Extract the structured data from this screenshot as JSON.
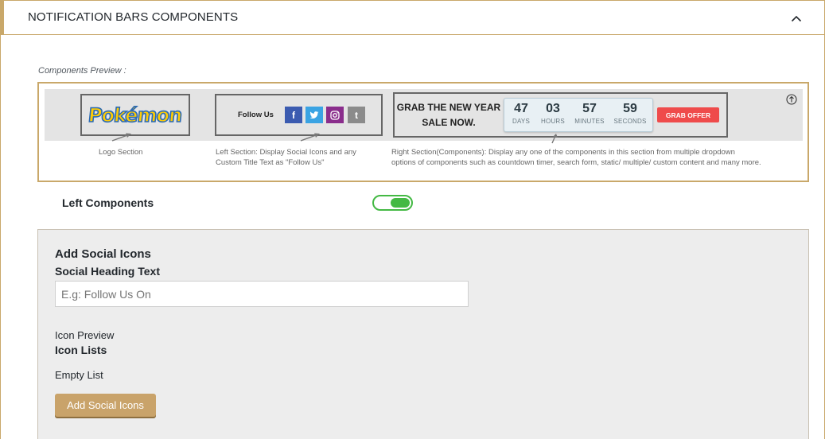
{
  "panel": {
    "title": "NOTIFICATION BARS COMPONENTS"
  },
  "preview": {
    "label": "Components Preview :",
    "follow_text": "Follow Us",
    "logo_text": "Pokémon",
    "grab_line1": "GRAB THE NEW YEAR",
    "grab_line2": "SALE NOW.",
    "countdown": [
      {
        "value": "47",
        "unit": "DAYS"
      },
      {
        "value": "03",
        "unit": "HOURS"
      },
      {
        "value": "57",
        "unit": "MINUTES"
      },
      {
        "value": "59",
        "unit": "SECONDS"
      }
    ],
    "offer_label": "GRAB OFFER",
    "desc_logo": "Logo Section",
    "desc_left_1": "Left Section: Display Social Icons and any",
    "desc_left_2": "Custom Title  Text as \"Follow Us\"",
    "desc_right_1": "Right Section(Components): Display any one of the components in this section from multiple dropdown",
    "desc_right_2": "options of components such as countdown timer, search form, static/ multiple/ custom content and many more."
  },
  "left_components": {
    "label": "Left Components",
    "enabled": true
  },
  "social": {
    "heading": "Add Social Icons",
    "heading_text_label": "Social Heading Text",
    "input_placeholder": "E.g: Follow Us On",
    "icon_preview_label": "Icon Preview",
    "icon_lists_label": "Icon Lists",
    "empty_list_label": "Empty List",
    "add_button_label": "Add Social Icons"
  },
  "colors": {
    "accent": "#c9a86a",
    "toggle": "#44b944",
    "facebook": "#3b5bb0",
    "twitter": "#3aa3e3",
    "instagram": "#8a2d8c",
    "tumblr": "#8b8b8b",
    "offer": "#ef4b4b"
  },
  "icons": {
    "collapse": "chevron-up-icon",
    "scroll_top": "arrow-up-circle-icon",
    "facebook": "facebook-icon",
    "twitter": "twitter-icon",
    "instagram": "instagram-icon",
    "tumblr": "tumblr-icon"
  }
}
